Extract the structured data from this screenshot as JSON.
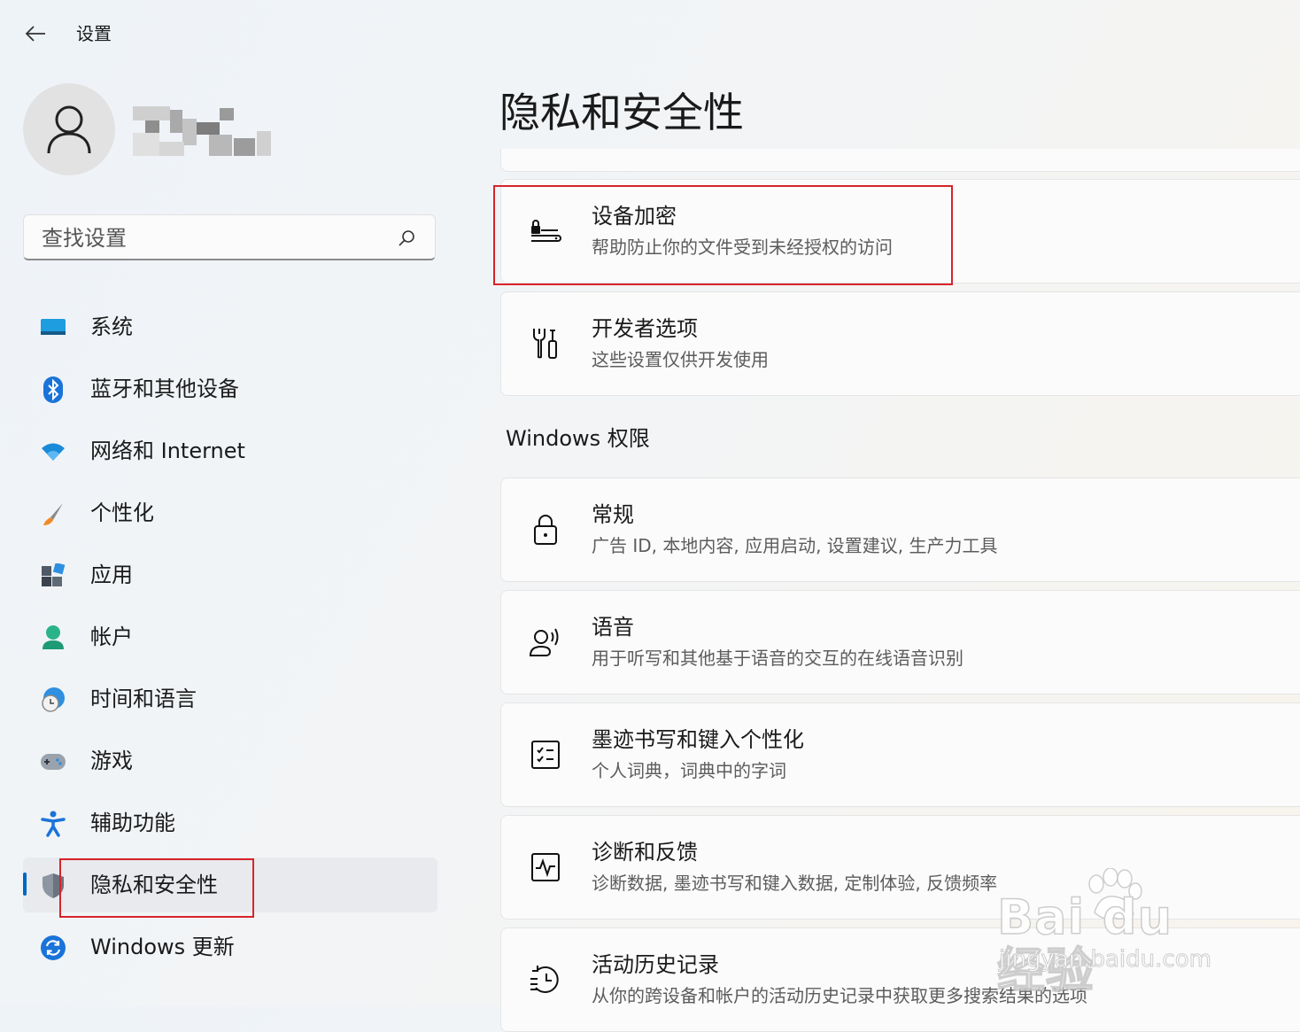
{
  "window": {
    "title": "设置",
    "back_icon": "arrow-left-icon"
  },
  "profile": {
    "avatar_icon": "person-icon"
  },
  "search": {
    "placeholder": "查找设置",
    "icon": "search-icon"
  },
  "sidebar": {
    "items": [
      {
        "label": "系统",
        "icon": "monitor-icon",
        "selected": false
      },
      {
        "label": "蓝牙和其他设备",
        "icon": "bluetooth-icon",
        "selected": false
      },
      {
        "label": "网络和 Internet",
        "icon": "wifi-icon",
        "selected": false
      },
      {
        "label": "个性化",
        "icon": "paintbrush-icon",
        "selected": false
      },
      {
        "label": "应用",
        "icon": "apps-icon",
        "selected": false
      },
      {
        "label": "帐户",
        "icon": "account-icon",
        "selected": false
      },
      {
        "label": "时间和语言",
        "icon": "globe-clock-icon",
        "selected": false
      },
      {
        "label": "游戏",
        "icon": "gamepad-icon",
        "selected": false
      },
      {
        "label": "辅助功能",
        "icon": "accessibility-icon",
        "selected": false
      },
      {
        "label": "隐私和安全性",
        "icon": "shield-icon",
        "selected": true
      },
      {
        "label": "Windows 更新",
        "icon": "windows-update-icon",
        "selected": false
      }
    ]
  },
  "main": {
    "title": "隐私和安全性",
    "cards_top": [
      {
        "title": "设备加密",
        "subtitle": "帮助防止你的文件受到未经授权的访问",
        "icon": "device-encryption-icon"
      },
      {
        "title": "开发者选项",
        "subtitle": "这些设置仅供开发使用",
        "icon": "developer-tools-icon"
      }
    ],
    "section_heading": "Windows 权限",
    "cards_permissions": [
      {
        "title": "常规",
        "subtitle": "广告 ID, 本地内容, 应用启动, 设置建议, 生产力工具",
        "icon": "lock-icon"
      },
      {
        "title": "语音",
        "subtitle": "用于听写和其他基于语音的交互的在线语音识别",
        "icon": "speech-icon"
      },
      {
        "title": "墨迹书写和键入个性化",
        "subtitle": "个人词典，词典中的字词",
        "icon": "ink-typing-icon"
      },
      {
        "title": "诊断和反馈",
        "subtitle": "诊断数据, 墨迹书写和键入数据, 定制体验, 反馈频率",
        "icon": "diagnostics-icon"
      },
      {
        "title": "活动历史记录",
        "subtitle": "从你的跨设备和帐户的活动历史记录中获取更多搜索结果的选项",
        "icon": "history-icon"
      }
    ]
  },
  "watermark": {
    "brand": "Bai du 经验",
    "url": "jingyan.baidu.com"
  },
  "colors": {
    "accent": "#0067c0",
    "highlight_box": "#d8232a"
  }
}
